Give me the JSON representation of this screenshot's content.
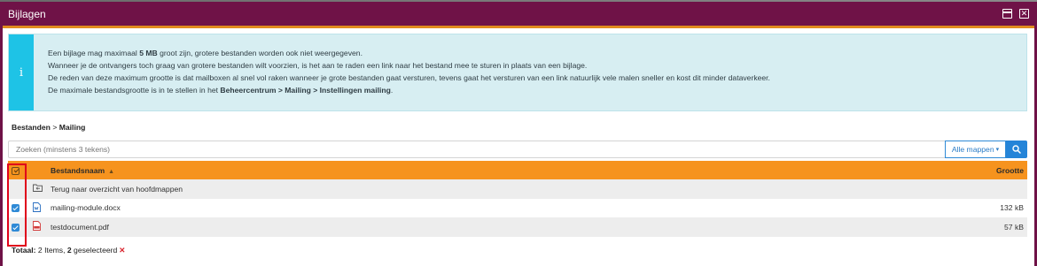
{
  "window": {
    "title": "Bijlagen"
  },
  "info": {
    "line1_pre": "Een bijlage mag maximaal ",
    "line1_bold": "5 MB",
    "line1_post": " groot zijn, grotere bestanden worden ook niet weergegeven.",
    "line2": "Wanneer je de ontvangers toch graag van grotere bestanden wilt voorzien, is het aan te raden een link naar het bestand mee te sturen in plaats van een bijlage.",
    "line3": "De reden van deze maximum grootte is dat mailboxen al snel vol raken wanneer je grote bestanden gaat versturen, tevens gaat het versturen van een link natuurlijk vele malen sneller en kost dit minder dataverkeer.",
    "line4_pre": "De maximale bestandsgrootte is in te stellen in het ",
    "line4_bold": "Beheercentrum > Mailing > Instellingen mailing",
    "line4_post": "."
  },
  "breadcrumb": {
    "root": "Bestanden",
    "separator": " > ",
    "current": "Mailing"
  },
  "search": {
    "placeholder": "Zoeken (minstens 3 tekens)",
    "folder_label": "Alle mappen",
    "caret": "▾"
  },
  "table": {
    "columns": {
      "name": "Bestandsnaam",
      "size": "Grootte"
    },
    "back_row": "Terug naar overzicht van hoofdmappen",
    "rows": [
      {
        "name": "mailing-module.docx",
        "size": "132 kB",
        "checked": true,
        "icon": "word-file-icon"
      },
      {
        "name": "testdocument.pdf",
        "size": "57 kB",
        "checked": true,
        "icon": "pdf-file-icon"
      }
    ]
  },
  "footer": {
    "label": "Totaal:",
    "count": "2",
    "items_text": " Items, ",
    "selected_count": "2",
    "selected_text": " geselecteerd",
    "clear_symbol": "✕"
  },
  "colors": {
    "titlebar": "#6f1247",
    "header_row": "#f6931e",
    "info_bg": "#d7eef2",
    "info_accent": "#1ec3e6",
    "primary": "#2484d8",
    "highlight_box": "#e0001b"
  }
}
